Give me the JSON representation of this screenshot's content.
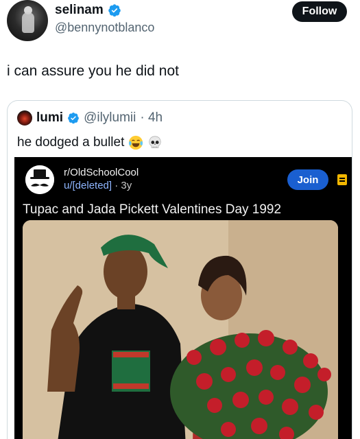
{
  "post": {
    "author_name": "selinam",
    "author_handle": "@bennynotblanco",
    "follow_label": "Follow",
    "text": "i can assure you he did not"
  },
  "quote": {
    "author_name": "lumi",
    "author_handle": "@ilylumii",
    "time": "· 4h",
    "text": "he dodged a bullet",
    "emojis": [
      "laughing-crying-emoji",
      "skull-emoji"
    ]
  },
  "reddit": {
    "subreddit": "r/OldSchoolCool",
    "user": "u/[deleted]",
    "age": "· 3y",
    "join_label": "Join",
    "title": "Tupac and Jada Pickett Valentines Day 1992"
  },
  "colors": {
    "verified": "#1d9bf0",
    "follow_bg": "#0f1419",
    "join_bg": "#1a5fd0",
    "save_icon": "#f2b600",
    "reddit_bg": "#000000"
  }
}
